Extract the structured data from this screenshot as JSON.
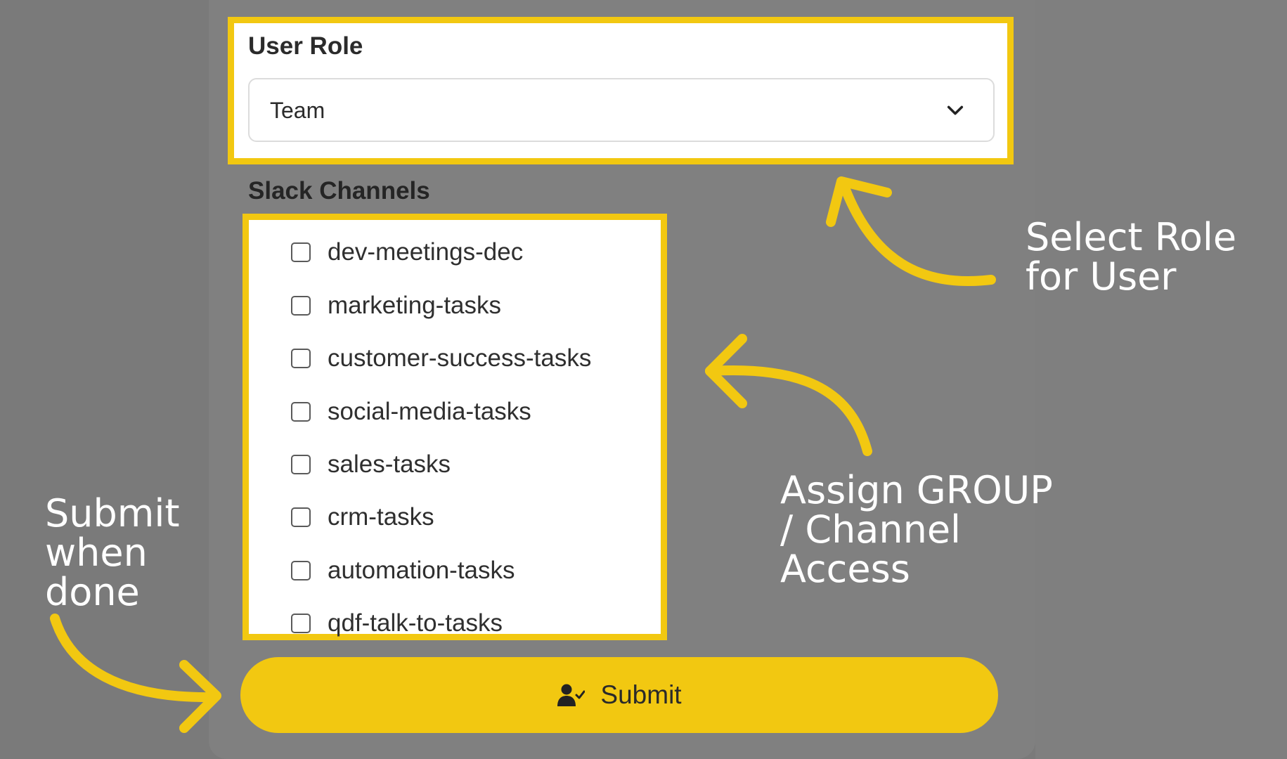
{
  "form": {
    "user_role": {
      "label": "User Role",
      "selected": "Team"
    },
    "slack_channels": {
      "label": "Slack Channels",
      "items": [
        {
          "name": "dev-meetings-dec",
          "checked": false
        },
        {
          "name": "marketing-tasks",
          "checked": false
        },
        {
          "name": "customer-success-tasks",
          "checked": false
        },
        {
          "name": "social-media-tasks",
          "checked": false
        },
        {
          "name": "sales-tasks",
          "checked": false
        },
        {
          "name": "crm-tasks",
          "checked": false
        },
        {
          "name": "automation-tasks",
          "checked": false
        },
        {
          "name": "qdf-talk-to-tasks",
          "checked": false
        }
      ]
    },
    "submit": {
      "label": "Submit",
      "icon": "user-check-icon"
    }
  },
  "annotations": {
    "role": "Select Role for User",
    "channels": "Assign GROUP / Channel Access",
    "submit": "Submit when done"
  },
  "colors": {
    "highlight": "#f2c811",
    "background": "#7a7a7a",
    "annotation_text": "#ffffff"
  }
}
